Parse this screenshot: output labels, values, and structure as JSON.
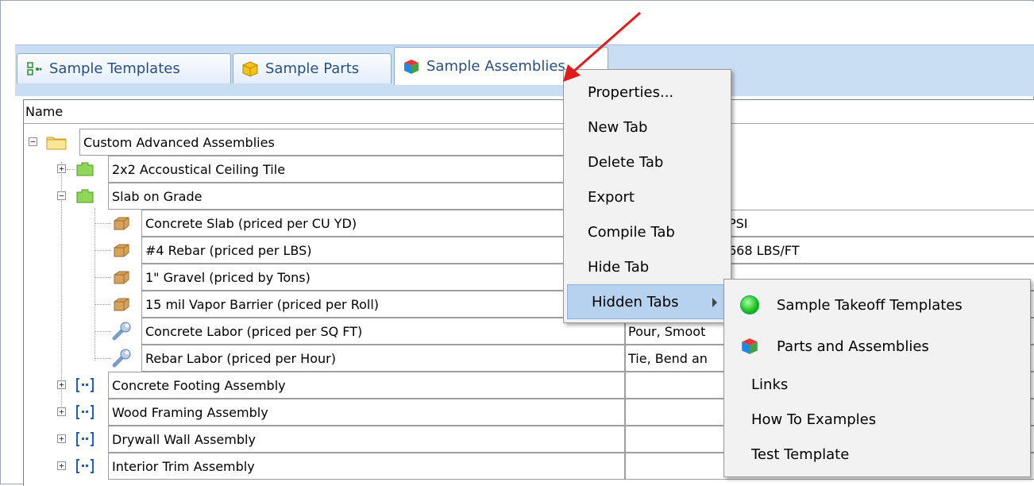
{
  "tabs": [
    {
      "label": "Sample Templates",
      "icon": "templates-icon",
      "active": false
    },
    {
      "label": "Sample Parts",
      "icon": "part-box-icon",
      "active": false
    },
    {
      "label": "Sample Assemblies",
      "icon": "assembly-cube-icon",
      "active": true
    }
  ],
  "table": {
    "header": "Name",
    "rows": [
      {
        "name": "Custom Advanced Assemblies",
        "desc": "",
        "icon": "folder-icon",
        "expander": "−"
      },
      {
        "name": "2x2 Accoustical Ceiling Tile",
        "desc": "",
        "icon": "assembly-green-icon",
        "expander": "+"
      },
      {
        "name": "Slab on Grade",
        "desc": "",
        "icon": "assembly-green-icon",
        "expander": "−"
      },
      {
        "name": "Concrete Slab (priced per CU YD)",
        "desc": "PSI",
        "icon": "part-box-icon"
      },
      {
        "name": "#4 Rebar (priced per LBS)",
        "desc": "668 LBS/FT",
        "icon": "part-box-icon"
      },
      {
        "name": "1\" Gravel (priced by Tons)",
        "desc": "",
        "icon": "part-box-icon"
      },
      {
        "name": "15 mil Vapor Barrier (priced per Roll)",
        "desc": "",
        "icon": "part-box-icon"
      },
      {
        "name": "Concrete Labor (priced per SQ FT)",
        "desc": "Pour, Smoot",
        "icon": "wrench-icon"
      },
      {
        "name": "Rebar Labor (priced per Hour)",
        "desc": "Tie, Bend an",
        "icon": "wrench-icon"
      },
      {
        "name": "Concrete Footing Assembly",
        "desc": "",
        "icon": "assembly-blue-icon",
        "expander": "+"
      },
      {
        "name": "Wood Framing Assembly",
        "desc": "",
        "icon": "assembly-blue-icon",
        "expander": "+"
      },
      {
        "name": "Drywall Wall Assembly",
        "desc": "",
        "icon": "assembly-blue-icon",
        "expander": "+"
      },
      {
        "name": "Interior Trim Assembly",
        "desc": "",
        "icon": "assembly-blue-icon",
        "expander": "+"
      }
    ]
  },
  "context_menu": {
    "items": [
      "Properties...",
      "New Tab",
      "Delete Tab",
      "Export",
      "Compile Tab",
      "Hide Tab",
      "Hidden Tabs"
    ]
  },
  "hidden_tabs_menu": {
    "items": [
      "Sample Takeoff Templates",
      "Parts and Assemblies",
      "Links",
      "How To Examples",
      "Test Template"
    ]
  },
  "colors": {
    "tabbar_bg": "#c9ddf3",
    "menu_highlight": "#b7d2ee",
    "annotation_arrow": "#e21b1b"
  }
}
